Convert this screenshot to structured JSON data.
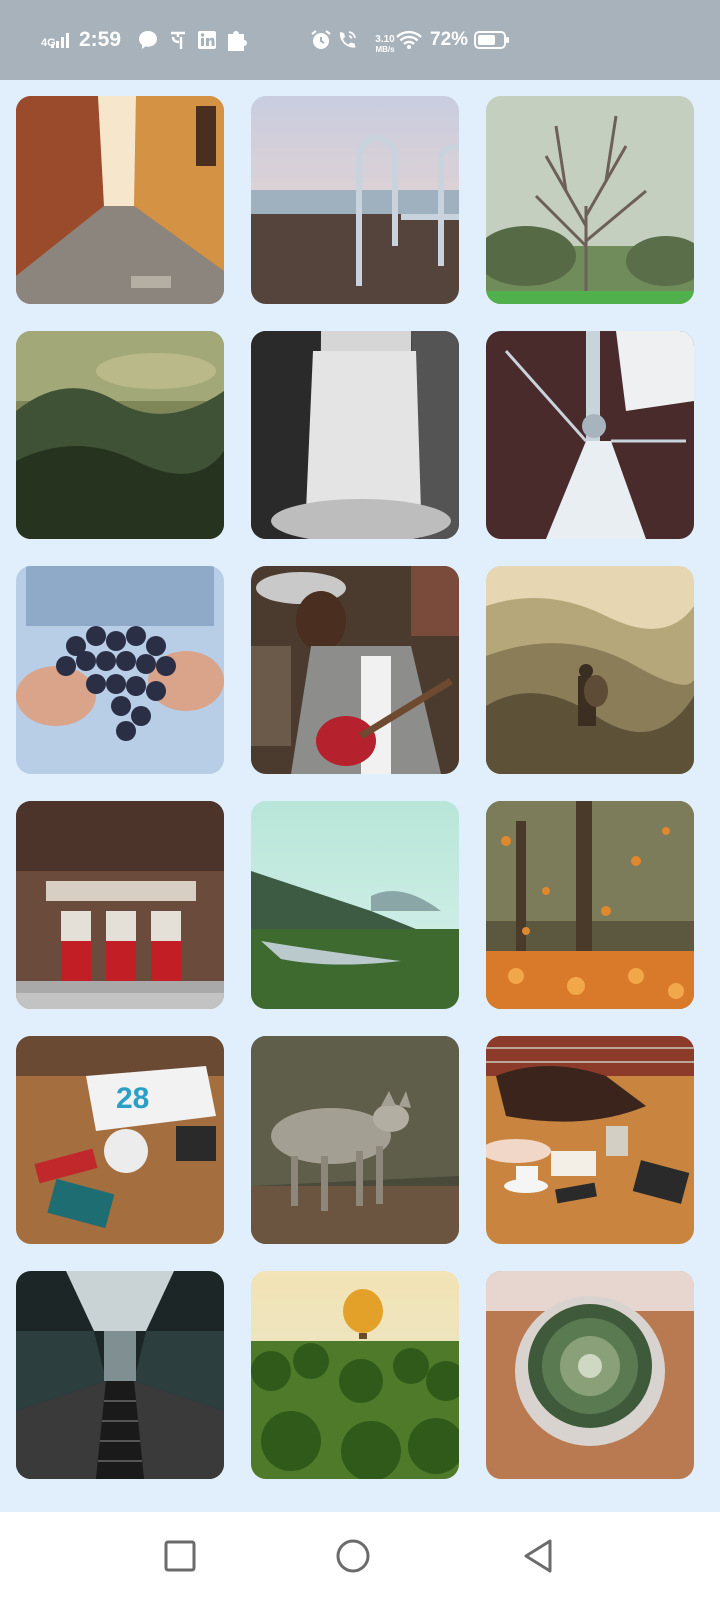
{
  "status_bar": {
    "network_type": "4G",
    "time": "2:59",
    "net_speed_value": "3.10",
    "net_speed_unit": "MB/s",
    "battery_percent": "72%",
    "left_icons": [
      "message-icon",
      "phonepe-icon",
      "linkedin-icon",
      "puzzle-icon"
    ],
    "right_icons": [
      "alarm-icon",
      "wifi-calling-icon",
      "wifi-icon",
      "battery-icon"
    ],
    "background_color": "#a7b2bb"
  },
  "gallery": {
    "background_color": "#e1effc",
    "photos": [
      {
        "subject": "narrow-alley"
      },
      {
        "subject": "dock-ladder"
      },
      {
        "subject": "bare-tree"
      },
      {
        "subject": "misty-forest"
      },
      {
        "subject": "waterfall"
      },
      {
        "subject": "sailboat-bow"
      },
      {
        "subject": "grapes-in-hands"
      },
      {
        "subject": "woman-guitar"
      },
      {
        "subject": "hiker-valley"
      },
      {
        "subject": "massey-hall"
      },
      {
        "subject": "river-valley"
      },
      {
        "subject": "autumn-leaves"
      },
      {
        "subject": "design-desk"
      },
      {
        "subject": "coyote"
      },
      {
        "subject": "cafe-table"
      },
      {
        "subject": "subway-escalator"
      },
      {
        "subject": "hot-air-balloon"
      },
      {
        "subject": "cactus-pot"
      }
    ]
  },
  "nav_bar": {
    "buttons": [
      "recents-button",
      "home-button",
      "back-button"
    ]
  }
}
